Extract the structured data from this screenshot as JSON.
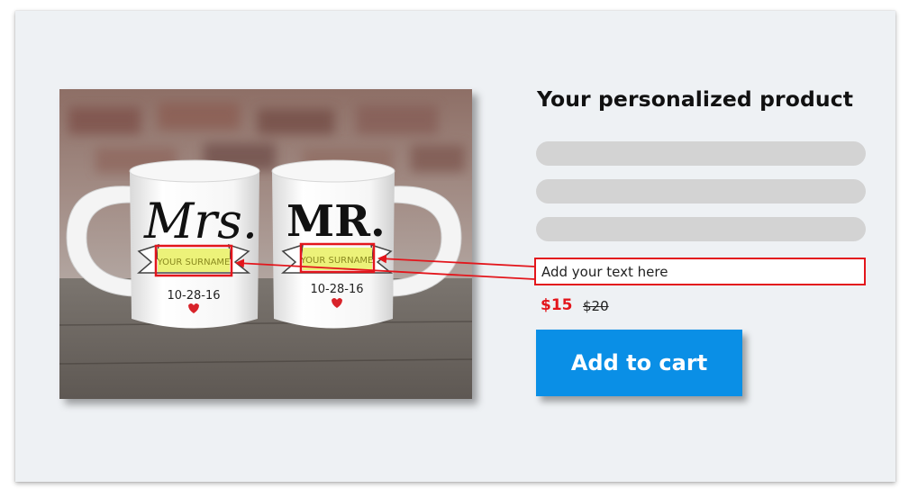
{
  "product": {
    "title": "Your personalized product",
    "input_placeholder": "Add your text here",
    "price": "$15",
    "old_price": "$20",
    "add_to_cart": "Add to cart"
  },
  "mugs": {
    "left_heading": "Mrs.",
    "right_heading": "MR.",
    "surname_label": "YOUR SURNAME",
    "date": "10-28-16"
  },
  "colors": {
    "accent": "#e3161c",
    "button": "#0a8fe6",
    "highlight": "#ecf279",
    "background": "#eef1f4",
    "placeholder_bar": "#d3d3d3"
  }
}
